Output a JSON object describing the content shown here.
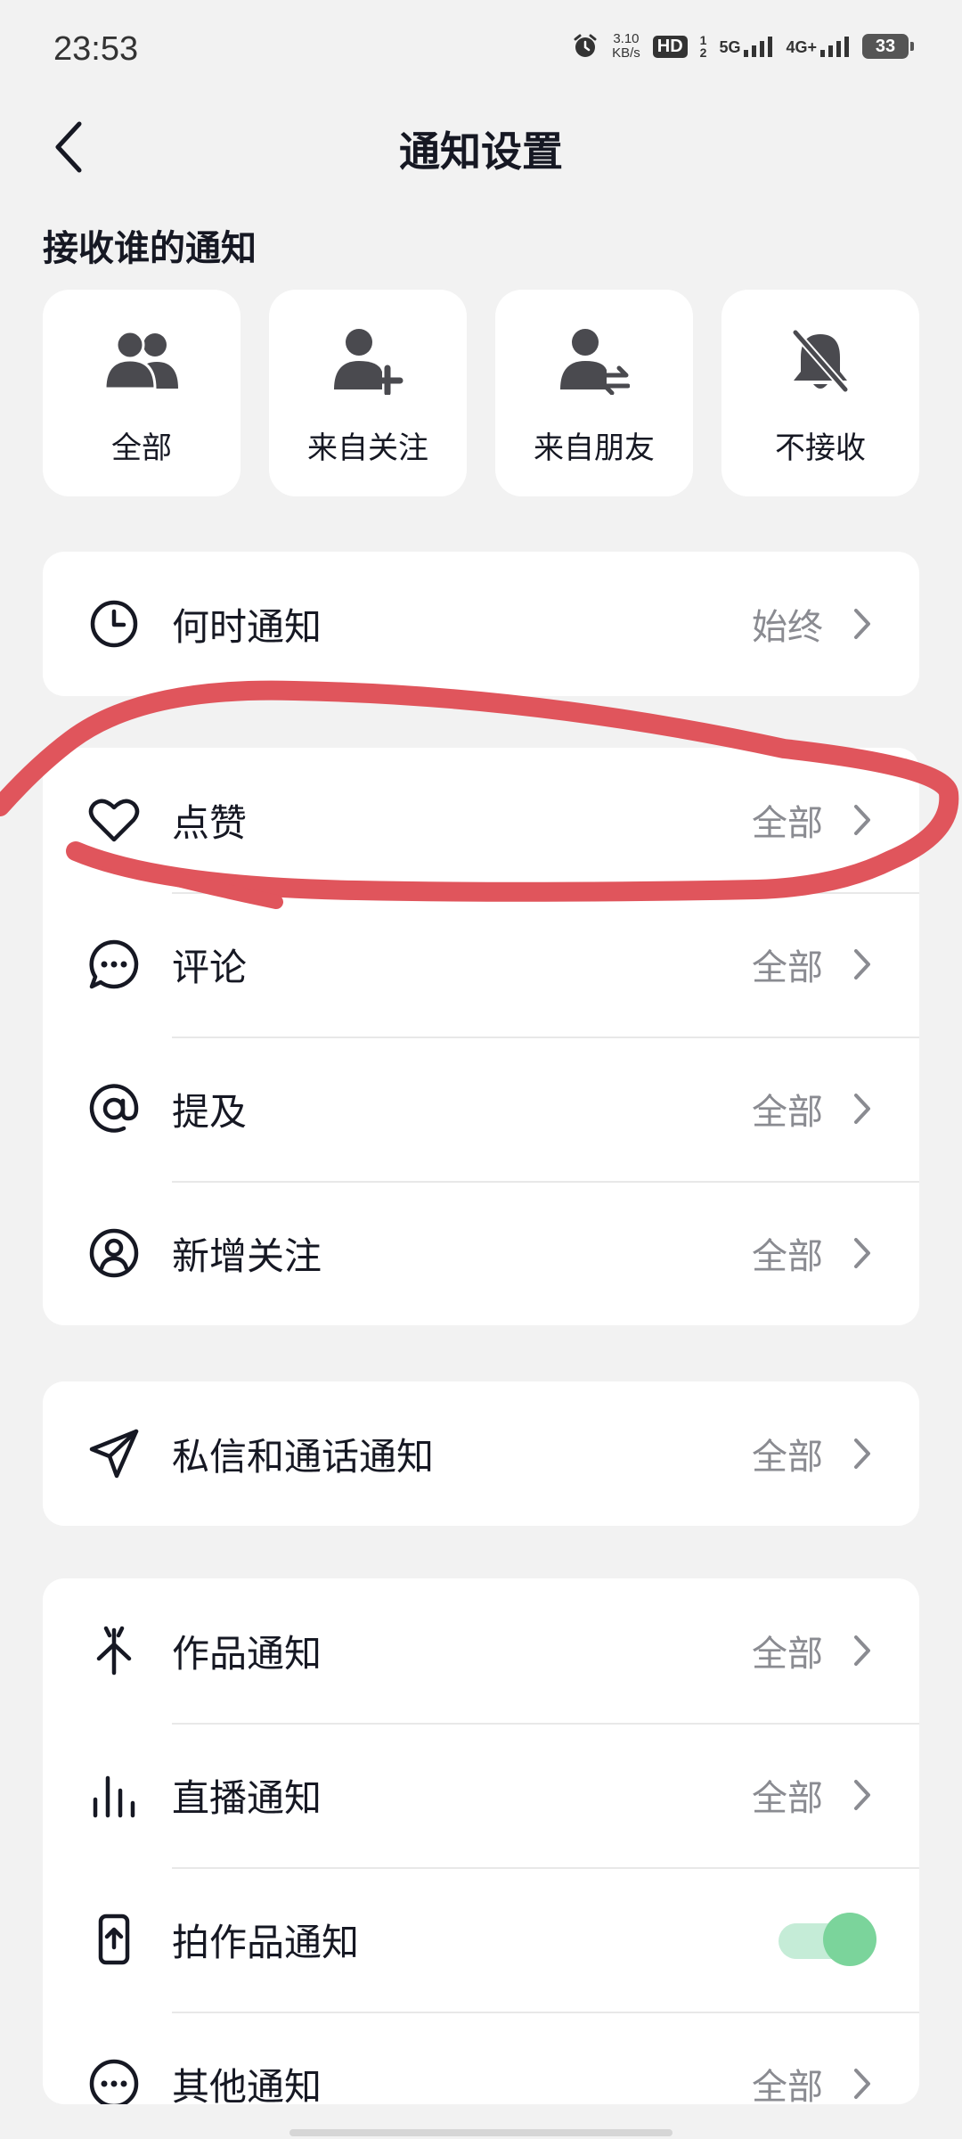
{
  "status_bar": {
    "time": "23:53",
    "net_speed_value": "3.10",
    "net_speed_unit": "KB/s",
    "hd_label": "HD",
    "sim1_sub": "1",
    "sim2_sub": "2",
    "signal1": "5G",
    "signal2": "4G+",
    "battery": "33"
  },
  "nav": {
    "title": "通知设置"
  },
  "receive_section": {
    "label": "接收谁的通知",
    "options": [
      {
        "label": "全部",
        "icon": "people-icon"
      },
      {
        "label": "来自关注",
        "icon": "person-add-icon"
      },
      {
        "label": "来自朋友",
        "icon": "person-swap-icon"
      },
      {
        "label": "不接收",
        "icon": "bell-off-icon"
      }
    ]
  },
  "when_card": {
    "rows": [
      {
        "label": "何时通知",
        "value": "始终",
        "icon": "clock-icon"
      }
    ]
  },
  "interaction_card": {
    "rows": [
      {
        "label": "点赞",
        "value": "全部",
        "icon": "heart-icon"
      },
      {
        "label": "评论",
        "value": "全部",
        "icon": "comment-icon"
      },
      {
        "label": "提及",
        "value": "全部",
        "icon": "at-icon"
      },
      {
        "label": "新增关注",
        "value": "全部",
        "icon": "user-circle-icon"
      }
    ]
  },
  "message_card": {
    "rows": [
      {
        "label": "私信和通话通知",
        "value": "全部",
        "icon": "send-icon"
      }
    ]
  },
  "content_card": {
    "rows": [
      {
        "label": "作品通知",
        "value": "全部",
        "icon": "sparkle-arrow-icon"
      },
      {
        "label": "直播通知",
        "value": "全部",
        "icon": "live-bars-icon"
      },
      {
        "label": "拍作品通知",
        "toggle_on": true,
        "icon": "phone-upload-icon"
      },
      {
        "label": "其他通知",
        "value": "全部",
        "icon": "more-circle-icon"
      }
    ]
  },
  "colors": {
    "background": "#f2f2f2",
    "card": "#ffffff",
    "annotation_red": "#e0555c",
    "toggle_green": "#7bd49b"
  }
}
